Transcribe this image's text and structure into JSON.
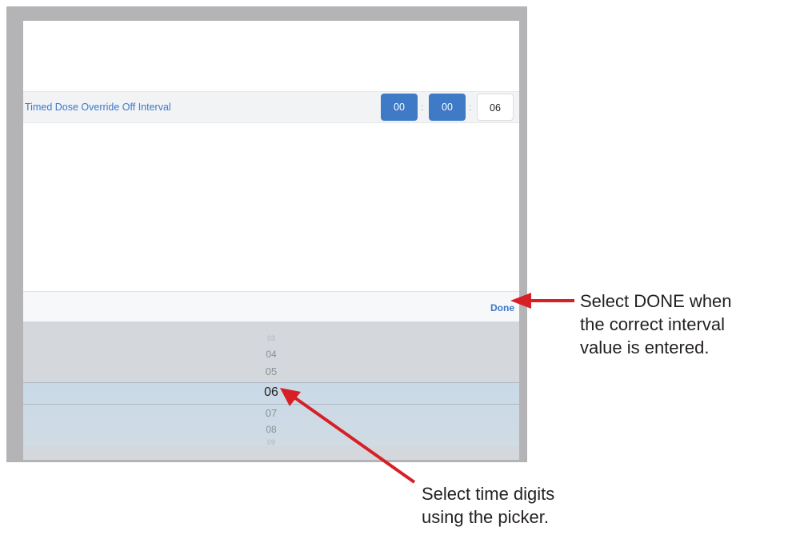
{
  "setting": {
    "label": "Timed Dose Override Off Interval",
    "hours": "00",
    "minutes": "00",
    "seconds": "06",
    "separator": ":"
  },
  "toolbar": {
    "done_label": "Done"
  },
  "picker": {
    "items": [
      "03",
      "04",
      "05",
      "06",
      "07",
      "08",
      "09"
    ],
    "selected": "06"
  },
  "callouts": {
    "done_line1": "Select DONE when",
    "done_line2": "the correct interval",
    "done_line3": "value is entered.",
    "picker_line1": "Select time digits",
    "picker_line2": "using the picker."
  },
  "colors": {
    "accent": "#3f7ac6",
    "arrow": "#d71f26"
  }
}
